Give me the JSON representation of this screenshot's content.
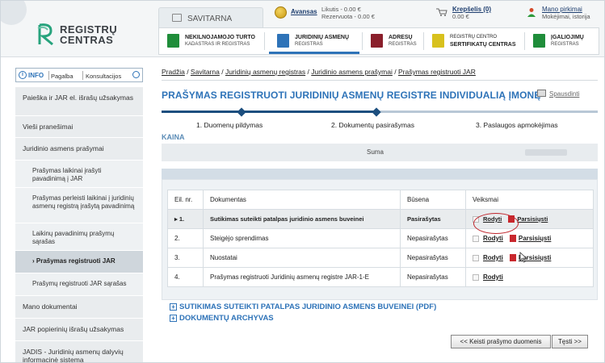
{
  "brand": {
    "line1": "REGISTRŲ",
    "line2": "CENTRAS"
  },
  "top": {
    "savitarna": "SAVITARNA",
    "avansas": "Avansas",
    "likutis": "Likutis - 0.00 €",
    "rezervuota": "Rezervuota - 0.00 €",
    "krepselis": "Krepšelis (0)",
    "krepselis_sum": "0.00 €",
    "pirkimai": "Mano pirkimai",
    "pirkimai_sub": "Mokėjimai, istorija"
  },
  "nav": [
    {
      "title": "NEKILNOJAMOJO TURTO",
      "sub": "KADASTRAS IR REGISTRAS",
      "color": "#1f8d3a",
      "icon": "realestate-icon"
    },
    {
      "title": "JURIDINIŲ ASMENŲ",
      "sub": "REGISTRAS",
      "color": "#2e73b8",
      "icon": "legal-entity-icon"
    },
    {
      "title": "ADRESŲ",
      "sub": "REGISTRAS",
      "color": "#8a1f2b",
      "icon": "address-icon"
    },
    {
      "title": "REGISTRŲ CENTRO",
      "sub": "SERTIFIKATŲ CENTRAS",
      "color": "#d8c11d",
      "icon": "certificate-icon"
    },
    {
      "title": "ĮGALIOJIMŲ",
      "sub": "REGISTRAS",
      "color": "#1f8d3a",
      "icon": "power-of-attorney-icon"
    }
  ],
  "info": {
    "label": "INFO",
    "pagalba": "Pagalba",
    "konsultacijos": "Konsultacijos"
  },
  "sidebar": [
    "Paieška ir JAR el. išrašų užsakymas",
    "Vieši pranešimai",
    "Juridinio asmens prašymai",
    "Prašymas laikinai įrašyti pavadinimą į JAR",
    "Prašymas perleisti laikinai į juridinių asmenų registrą įrašytą pavadinimą",
    "Laikinų pavadinimų prašymų sąrašas",
    "› Prašymas registruoti JAR",
    "Prašymų registruoti JAR sąrašas",
    "Mano dokumentai",
    "JAR popierinių išrašų užsakymas",
    "JADIS - Juridinių asmenų dalyvių informacinė sistema"
  ],
  "breadcrumb": [
    "Pradžia",
    "Savitarna",
    "Juridinių asmenų registras",
    "Juridinio asmens prašymai",
    "Prašymas registruoti JAR"
  ],
  "page_title": "PRAŠYMAS REGISTRUOTI JURIDINIŲ ASMENŲ REGISTRE INDIVIDUALIĄ ĮMONĘ",
  "print": "Spausdinti",
  "steps": [
    "1. Duomenų pildymas",
    "2. Dokumentų pasirašymas",
    "3. Paslaugos apmokėjimas"
  ],
  "progress": {
    "current_step": 2,
    "total_steps": 3
  },
  "kaina": {
    "label": "KAINA",
    "suma": "Suma"
  },
  "table": {
    "headers": [
      "Eil. nr.",
      "Dokumentas",
      "Būsena",
      "Veiksmai"
    ],
    "rows": [
      {
        "nr": "▸ 1.",
        "doc": "Sutikimas suteikti patalpas juridinio asmens buveinei",
        "status": "Pasirašytas"
      },
      {
        "nr": "2.",
        "doc": "Steigėjo sprendimas",
        "status": "Nepasirašytas"
      },
      {
        "nr": "3.",
        "doc": "Nuostatai",
        "status": "Nepasirašytas"
      },
      {
        "nr": "4.",
        "doc": "Prašymas registruoti Juridinių asmenų registre JAR-1-E",
        "status": "Nepasirašytas"
      }
    ],
    "rodyti": "Rodyti",
    "parsisiusti": "Parsisiųsti"
  },
  "expanders": [
    "SUTIKIMAS SUTEIKTI PATALPAS JURIDINIO ASMENS BUVEINEI (PDF)",
    "DOKUMENTŲ ARCHYVAS"
  ],
  "buttons": {
    "back": "<< Keisti prašymo duomenis",
    "next": "Tęsti >>"
  },
  "colors": {
    "accent": "#2e73b8",
    "dark": "#1d4f7f",
    "highlight": "#c0262d"
  }
}
